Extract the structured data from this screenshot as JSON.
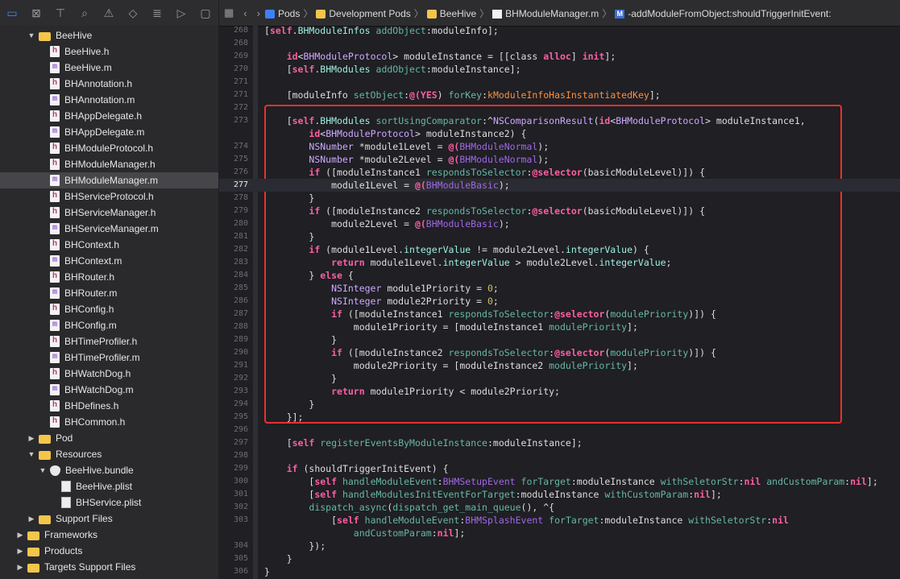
{
  "navigator": {
    "toolbar_icons": [
      "folder-icon",
      "source-control-icon",
      "hierarchy-icon",
      "search-icon",
      "warning-icon",
      "breakpoint-icon",
      "list-icon",
      "tag-icon",
      "comment-icon"
    ],
    "tree": [
      {
        "label": "BeeHive",
        "type": "folder",
        "depth": 1,
        "disclosure": "open"
      },
      {
        "label": "BeeHive.h",
        "type": "h",
        "depth": 2
      },
      {
        "label": "BeeHive.m",
        "type": "m",
        "depth": 2
      },
      {
        "label": "BHAnnotation.h",
        "type": "h",
        "depth": 2
      },
      {
        "label": "BHAnnotation.m",
        "type": "m",
        "depth": 2
      },
      {
        "label": "BHAppDelegate.h",
        "type": "h",
        "depth": 2
      },
      {
        "label": "BHAppDelegate.m",
        "type": "m",
        "depth": 2
      },
      {
        "label": "BHModuleProtocol.h",
        "type": "h",
        "depth": 2
      },
      {
        "label": "BHModuleManager.h",
        "type": "h",
        "depth": 2
      },
      {
        "label": "BHModuleManager.m",
        "type": "m",
        "depth": 2,
        "selected": true
      },
      {
        "label": "BHServiceProtocol.h",
        "type": "h",
        "depth": 2
      },
      {
        "label": "BHServiceManager.h",
        "type": "h",
        "depth": 2
      },
      {
        "label": "BHServiceManager.m",
        "type": "m",
        "depth": 2
      },
      {
        "label": "BHContext.h",
        "type": "h",
        "depth": 2
      },
      {
        "label": "BHContext.m",
        "type": "m",
        "depth": 2
      },
      {
        "label": "BHRouter.h",
        "type": "h",
        "depth": 2
      },
      {
        "label": "BHRouter.m",
        "type": "m",
        "depth": 2
      },
      {
        "label": "BHConfig.h",
        "type": "h",
        "depth": 2
      },
      {
        "label": "BHConfig.m",
        "type": "m",
        "depth": 2
      },
      {
        "label": "BHTimeProfiler.h",
        "type": "h",
        "depth": 2
      },
      {
        "label": "BHTimeProfiler.m",
        "type": "m",
        "depth": 2
      },
      {
        "label": "BHWatchDog.h",
        "type": "h",
        "depth": 2
      },
      {
        "label": "BHWatchDog.m",
        "type": "m",
        "depth": 2
      },
      {
        "label": "BHDefines.h",
        "type": "h",
        "depth": 2
      },
      {
        "label": "BHCommon.h",
        "type": "h",
        "depth": 2
      },
      {
        "label": "Pod",
        "type": "folder",
        "depth": 1,
        "disclosure": "closed"
      },
      {
        "label": "Resources",
        "type": "folder",
        "depth": 1,
        "disclosure": "open"
      },
      {
        "label": "BeeHive.bundle",
        "type": "bundle",
        "depth": 2,
        "disclosure": "open"
      },
      {
        "label": "BeeHive.plist",
        "type": "plist",
        "depth": 3
      },
      {
        "label": "BHService.plist",
        "type": "plist",
        "depth": 3
      },
      {
        "label": "Support Files",
        "type": "folder",
        "depth": 1,
        "disclosure": "closed"
      },
      {
        "label": "Frameworks",
        "type": "folder",
        "depth": 0,
        "disclosure": "closed"
      },
      {
        "label": "Products",
        "type": "folder",
        "depth": 0,
        "disclosure": "closed"
      },
      {
        "label": "Targets Support Files",
        "type": "folder",
        "depth": 0,
        "disclosure": "closed"
      }
    ]
  },
  "jumpbar": {
    "crumbs": [
      {
        "label": "Pods",
        "icon": "pods"
      },
      {
        "label": "Development Pods",
        "icon": "folder"
      },
      {
        "label": "BeeHive",
        "icon": "folder"
      },
      {
        "label": "BHModuleManager.m",
        "icon": "mfile"
      },
      {
        "label": "-addModuleFromObject:shouldTriggerInitEvent:",
        "icon": "method"
      }
    ]
  },
  "editor": {
    "current_line": "277",
    "lines": [
      {
        "n": "268",
        "code": "[self.BHModuleInfos addObject:moduleInfo];"
      },
      {
        "n": "268",
        "code": ""
      },
      {
        "n": "269",
        "code": "    id<BHModuleProtocol> moduleInstance = [[class alloc] init];"
      },
      {
        "n": "270",
        "code": "    [self.BHModules addObject:moduleInstance];"
      },
      {
        "n": "271",
        "code": ""
      },
      {
        "n": "271",
        "code": "    [moduleInfo setObject:@(YES) forKey:kModuleInfoHasInstantiatedKey];"
      },
      {
        "n": "272",
        "code": ""
      },
      {
        "n": "273",
        "code": "    [self.BHModules sortUsingComparator:^NSComparisonResult(id<BHModuleProtocol> moduleInstance1,"
      },
      {
        "n": "",
        "code": "        id<BHModuleProtocol> moduleInstance2) {"
      },
      {
        "n": "274",
        "code": "        NSNumber *module1Level = @(BHModuleNormal);"
      },
      {
        "n": "275",
        "code": "        NSNumber *module2Level = @(BHModuleNormal);"
      },
      {
        "n": "276",
        "code": "        if ([moduleInstance1 respondsToSelector:@selector(basicModuleLevel)]) {"
      },
      {
        "n": "277",
        "code": "            module1Level = @(BHModuleBasic);"
      },
      {
        "n": "278",
        "code": "        }"
      },
      {
        "n": "279",
        "code": "        if ([moduleInstance2 respondsToSelector:@selector(basicModuleLevel)]) {"
      },
      {
        "n": "280",
        "code": "            module2Level = @(BHModuleBasic);"
      },
      {
        "n": "281",
        "code": "        }"
      },
      {
        "n": "282",
        "code": "        if (module1Level.integerValue != module2Level.integerValue) {"
      },
      {
        "n": "283",
        "code": "            return module1Level.integerValue > module2Level.integerValue;"
      },
      {
        "n": "284",
        "code": "        } else {"
      },
      {
        "n": "285",
        "code": "            NSInteger module1Priority = 0;"
      },
      {
        "n": "286",
        "code": "            NSInteger module2Priority = 0;"
      },
      {
        "n": "287",
        "code": "            if ([moduleInstance1 respondsToSelector:@selector(modulePriority)]) {"
      },
      {
        "n": "288",
        "code": "                module1Priority = [moduleInstance1 modulePriority];"
      },
      {
        "n": "289",
        "code": "            }"
      },
      {
        "n": "290",
        "code": "            if ([moduleInstance2 respondsToSelector:@selector(modulePriority)]) {"
      },
      {
        "n": "291",
        "code": "                module2Priority = [moduleInstance2 modulePriority];"
      },
      {
        "n": "292",
        "code": "            }"
      },
      {
        "n": "293",
        "code": "            return module1Priority < module2Priority;"
      },
      {
        "n": "294",
        "code": "        }"
      },
      {
        "n": "295",
        "code": "    }];"
      },
      {
        "n": "296",
        "code": ""
      },
      {
        "n": "297",
        "code": "    [self registerEventsByModuleInstance:moduleInstance];"
      },
      {
        "n": "298",
        "code": ""
      },
      {
        "n": "299",
        "code": "    if (shouldTriggerInitEvent) {"
      },
      {
        "n": "300",
        "code": "        [self handleModuleEvent:BHMSetupEvent forTarget:moduleInstance withSeletorStr:nil andCustomParam:nil];"
      },
      {
        "n": "301",
        "code": "        [self handleModulesInitEventForTarget:moduleInstance withCustomParam:nil];"
      },
      {
        "n": "302",
        "code": "        dispatch_async(dispatch_get_main_queue(), ^{"
      },
      {
        "n": "303",
        "code": "            [self handleModuleEvent:BHMSplashEvent forTarget:moduleInstance withSeletorStr:nil"
      },
      {
        "n": "",
        "code": "                andCustomParam:nil];"
      },
      {
        "n": "304",
        "code": "        });"
      },
      {
        "n": "305",
        "code": "    }"
      },
      {
        "n": "306",
        "code": "}"
      }
    ]
  },
  "colors": {
    "highlight_box": "#e8322c",
    "keyword": "#fc5fa3",
    "selection": "#46464a"
  }
}
